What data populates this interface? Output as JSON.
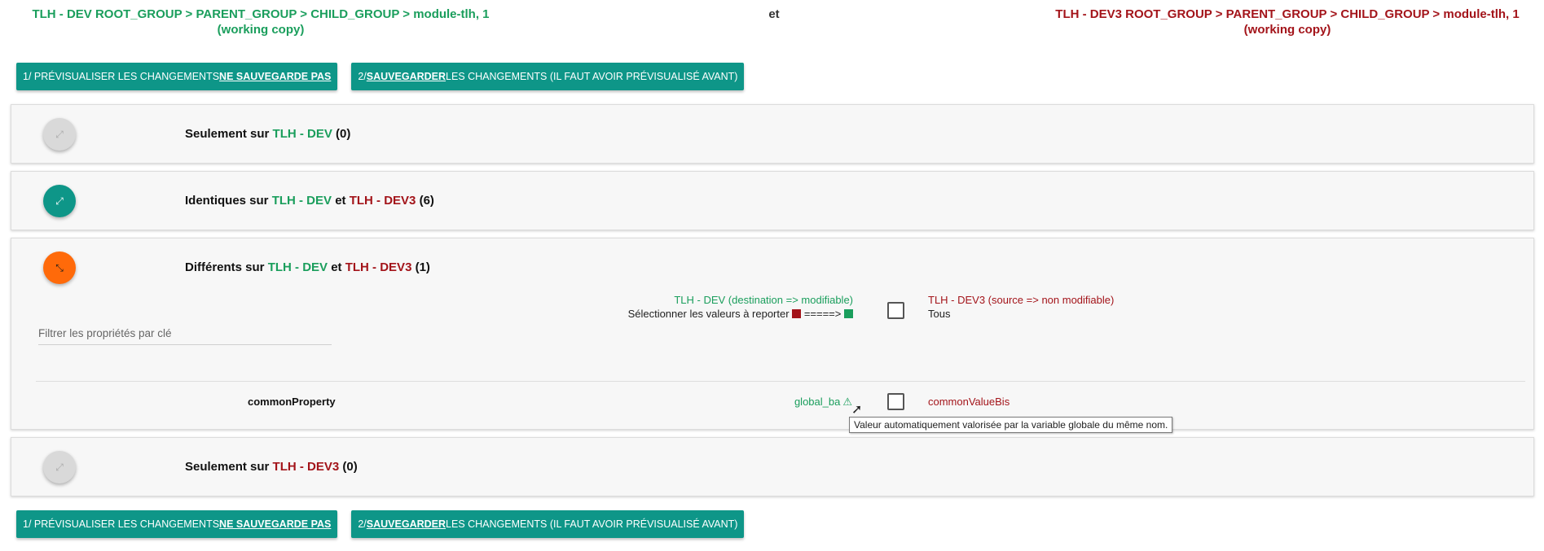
{
  "header": {
    "left": "TLH - DEV ROOT_GROUP > PARENT_GROUP > CHILD_GROUP > module-tlh, 1 (working copy)",
    "middle": "et",
    "right": "TLH - DEV3 ROOT_GROUP > PARENT_GROUP > CHILD_GROUP > module-tlh, 1 (working copy)"
  },
  "buttons": {
    "preview_prefix": "1/ Prévisualiser les changements ",
    "preview_emph": "ne sauvegarde pas",
    "save_prefix": "2/ ",
    "save_emph": "Sauvegarder",
    "save_suffix": " les changements (il faut avoir prévisualisé avant)"
  },
  "panels": {
    "only_dev": {
      "prefix": "Seulement sur ",
      "env": "TLH - DEV",
      "count": " (0)"
    },
    "identical": {
      "prefix": "Identiques sur ",
      "env1": "TLH - DEV",
      "mid": " et ",
      "env2": "TLH - DEV3",
      "count": " (6)"
    },
    "different": {
      "prefix": "Différents sur ",
      "env1": "TLH - DEV",
      "mid": " et ",
      "env2": "TLH - DEV3",
      "count": " (1)"
    },
    "only_dev3": {
      "prefix": "Seulement sur ",
      "env": "TLH - DEV3",
      "count": " (0)"
    }
  },
  "diff": {
    "dest_label": "TLH - DEV (destination => modifiable)",
    "select_label": "Sélectionner les valeurs à reporter",
    "arrow": "=====>",
    "src_label": "TLH - DEV3 (source => non modifiable)",
    "all_label": "Tous",
    "filter_placeholder": "Filtrer les propriétés par clé",
    "rows": [
      {
        "key": "commonProperty",
        "dest_value": "global_ba",
        "src_value": "commonValueBis"
      }
    ],
    "tooltip": "Valeur automatiquement valorisée par la variable globale du même nom."
  },
  "icons": {
    "expand": "expand-arrows-icon",
    "collapse": "collapse-arrows-icon",
    "warning": "warning-triangle-icon",
    "cursor": "mouse-pointer-icon"
  },
  "colors": {
    "dev": "#1a9e5c",
    "dev3": "#a3141a",
    "button": "#0e9688",
    "toggle_active": "#ff6a0a"
  }
}
